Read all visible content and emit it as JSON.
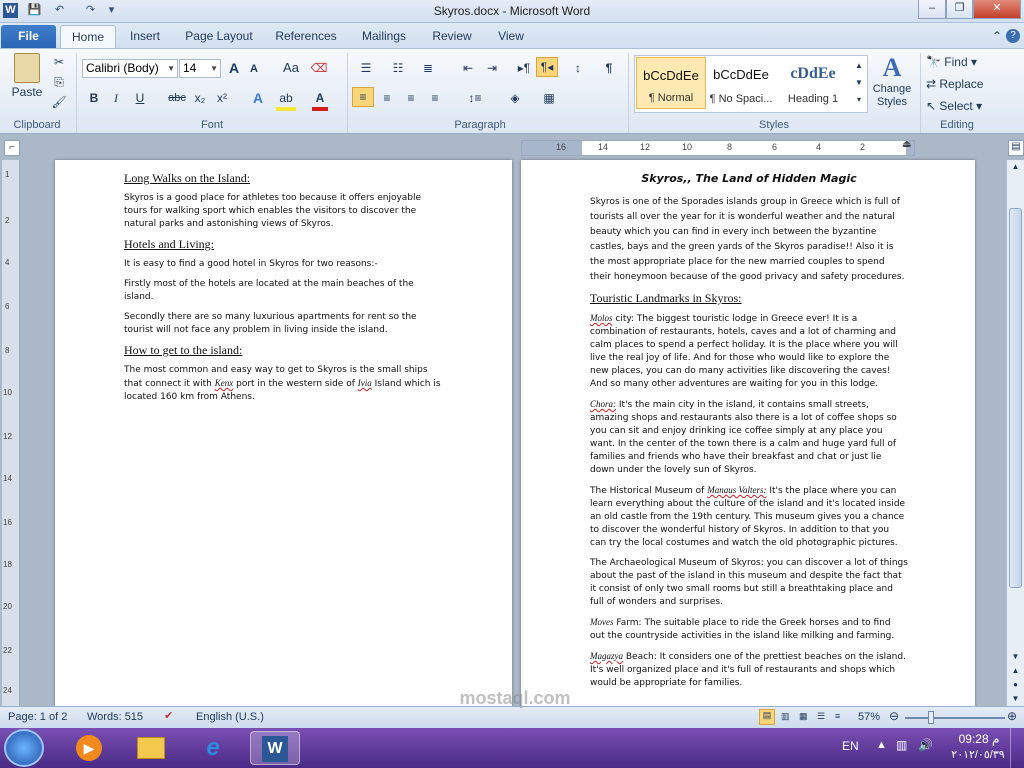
{
  "window": {
    "title": "Skyros.docx - Microsoft Word",
    "app_icon": "W",
    "controls": [
      "–",
      "❐",
      "✕"
    ]
  },
  "tabs": {
    "file": "File",
    "home": "Home",
    "insert": "Insert",
    "page_layout": "Page Layout",
    "references": "References",
    "mailings": "Mailings",
    "review": "Review",
    "view": "View"
  },
  "ribbon": {
    "clipboard": {
      "paste": "Paste",
      "label": "Clipboard"
    },
    "font": {
      "family": "Calibri (Body)",
      "size": "14",
      "label": "Font",
      "grow": "A",
      "shrink": "A",
      "case": "Aa",
      "bold": "B",
      "italic": "I",
      "underline": "U",
      "strike": "abc",
      "sub": "x₂",
      "sup": "x²"
    },
    "paragraph": {
      "label": "Paragraph",
      "show": "¶"
    },
    "styles": {
      "label": "Styles",
      "items": [
        {
          "sample": "bCcDdEe",
          "name": "¶ Normal"
        },
        {
          "sample": "bCcDdEe",
          "name": "¶ No Spaci..."
        },
        {
          "sample": "cDdEe",
          "name": "Heading 1"
        }
      ],
      "change": "Change Styles"
    },
    "editing": {
      "label": "Editing",
      "find": "Find",
      "replace": "Replace",
      "select": "Select"
    }
  },
  "ruler": {
    "ticks": [
      "16",
      "14",
      "12",
      "10",
      "8",
      "6",
      "4",
      "2"
    ],
    "vticks": [
      "1",
      "2",
      "4",
      "6",
      "8",
      "10",
      "12",
      "14",
      "16",
      "18",
      "20",
      "22",
      "24"
    ]
  },
  "page1": {
    "h1": "Long Walks on the Island:",
    "p1": "Skyros is a good place for athletes too because it offers enjoyable tours for walking sport which enables the visitors to discover the natural parks and astonishing views of Skyros.",
    "h2": "Hotels and Living:",
    "p2": "It is easy to find a good hotel in Skyros for two reasons:-",
    "p3": "Firstly most of the hotels are located at the main beaches of the island.",
    "p4": "Secondly there are so many luxurious apartments for rent so the tourist will not face any problem in living inside the island.",
    "h3": "How to get to the island:",
    "p5a": "The most common and easy way to get to Skyros is the small ships that connect it with",
    "p5b": "Kenx",
    "p5c": "port in the western side of",
    "p5d": "Ivia",
    "p5e": "Island which is located 160 km from Athens."
  },
  "page2": {
    "title": "Skyros,, The Land of Hidden Magic",
    "intro": "Skyros is one of the Sporades islands group in Greece which is full of tourists all over the year for it is wonderful weather and the natural beauty which you can find in every inch between the byzantine castles, bays and the green yards of the Skyros paradise!! Also it is the most appropriate place for the new married couples to spend their honeymoon because of the good privacy and safety procedures.",
    "h1": "Touristic Landmarks in Skyros:",
    "l1a": "Molos",
    "l1b": "city: The biggest touristic lodge in Greece ever! It is a combination of restaurants, hotels, caves and a lot of charming and calm places to spend a perfect holiday. It is the place where you will live the real joy of life. And for those who would like to explore the new places, you can do many activities like discovering the caves! And so many other adventures are waiting for you in this lodge.",
    "l2a": "Chora:",
    "l2b": "It's the main city in the island, it contains small streets, amazing shops and restaurants also there is a lot of coffee shops so you can sit and enjoy drinking ice coffee simply at any place you want. In the center of the town there is a calm and huge yard full of families and friends who have their breakfast and chat or just lie down under the lovely sun of Skyros.",
    "l3a": "The Historical Museum of",
    "l3b": "Manaus Valters:",
    "l3c": "It's the place where you can learn everything about the culture of the island and it's located inside an old castle from the 19th century. This museum gives you a chance to discover the wonderful history of Skyros. In addition to that you can try the local costumes and watch the old photographic pictures.",
    "l4": "The Archaeological Museum of Skyros: you can discover a lot of things about the past of the island in this museum and despite the fact that it consist of only two small rooms but still a breathtaking place and full of wonders and surprises.",
    "l5a": "Moves",
    "l5b": "Farm: The suitable place to ride the Greek horses and to find out the countryside activities in the island like milking and farming.",
    "l6a": "Magazya",
    "l6b": "Beach: It considers one of the prettiest beaches on the island. It's well organized place and it's full of restaurants and shops which would be appropriate for families."
  },
  "status": {
    "page": "Page: 1 of 2",
    "words": "Words: 515",
    "language": "English (U.S.)",
    "zoom": "57%"
  },
  "taskbar": {
    "lang": "EN",
    "time": "09:28 م",
    "date": "٢٠١٢/٠٥/٣٩"
  },
  "watermark": {
    "text": "mostaql.com"
  }
}
